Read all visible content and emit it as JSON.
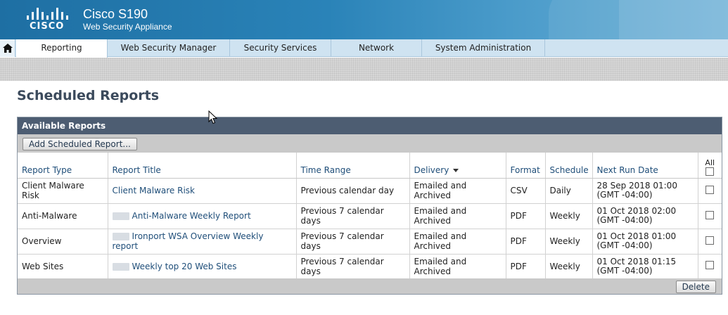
{
  "header": {
    "logo_text": "CISCO",
    "product_name": "Cisco S190",
    "product_subtitle": "Web Security Appliance",
    "colors": {
      "banner": "#2a83b8",
      "nav": "#cfe3f1",
      "panel_head": "#4d5d72"
    }
  },
  "nav": {
    "home_icon": "home-icon",
    "tabs": [
      {
        "label": "Reporting",
        "active": true
      },
      {
        "label": "Web Security Manager",
        "active": false
      },
      {
        "label": "Security Services",
        "active": false
      },
      {
        "label": "Network",
        "active": false
      },
      {
        "label": "System Administration",
        "active": false
      }
    ]
  },
  "page": {
    "title": "Scheduled Reports"
  },
  "panel": {
    "heading": "Available Reports",
    "add_button": "Add Scheduled Report...",
    "delete_button": "Delete",
    "columns": {
      "report_type": "Report Type",
      "report_title": "Report Title",
      "time_range": "Time Range",
      "delivery": "Delivery",
      "format": "Format",
      "schedule": "Schedule",
      "next_run": "Next Run Date",
      "all": "All"
    },
    "rows": [
      {
        "type": "Client Malware Risk",
        "title": "Client Malware Risk",
        "redacted": false,
        "time_range": "Previous calendar day",
        "delivery": "Emailed and Archived",
        "format": "CSV",
        "schedule": "Daily",
        "next_run_date": "28 Sep 2018 01:00",
        "next_run_tz": "(GMT -04:00)"
      },
      {
        "type": "Anti-Malware",
        "title": "Anti-Malware Weekly Report",
        "redacted": true,
        "time_range": "Previous 7 calendar days",
        "delivery": "Emailed and Archived",
        "format": "PDF",
        "schedule": "Weekly",
        "next_run_date": "01 Oct 2018 02:00",
        "next_run_tz": "(GMT -04:00)"
      },
      {
        "type": "Overview",
        "title": "Ironport WSA Overview Weekly report",
        "redacted": true,
        "time_range": "Previous 7 calendar days",
        "delivery": "Emailed and Archived",
        "format": "PDF",
        "schedule": "Weekly",
        "next_run_date": "01 Oct 2018 01:00",
        "next_run_tz": "(GMT -04:00)"
      },
      {
        "type": "Web Sites",
        "title": "Weekly top 20 Web Sites",
        "redacted": true,
        "time_range": "Previous 7 calendar days",
        "delivery": "Emailed and Archived",
        "format": "PDF",
        "schedule": "Weekly",
        "next_run_date": "01 Oct 2018 01:15",
        "next_run_tz": "(GMT -04:00)"
      }
    ]
  }
}
